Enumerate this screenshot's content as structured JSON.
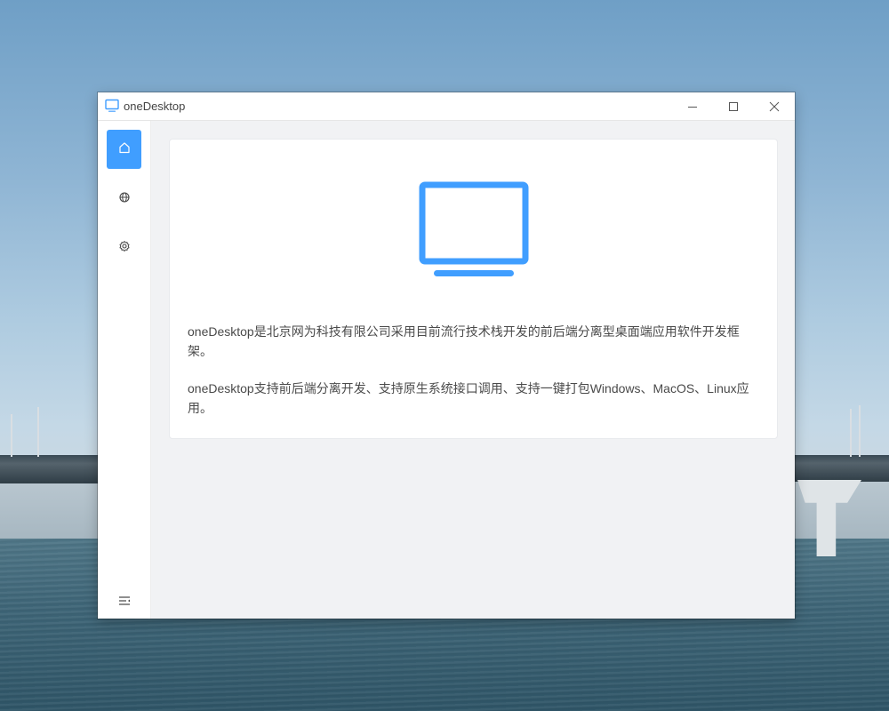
{
  "window": {
    "title": "oneDesktop",
    "controls": {
      "minimize_icon": "minimize-icon",
      "maximize_icon": "maximize-icon",
      "close_icon": "close-icon"
    }
  },
  "sidebar": {
    "items": [
      {
        "icon": "home-icon",
        "active": true
      },
      {
        "icon": "globe-icon",
        "active": false
      },
      {
        "icon": "gear-icon",
        "active": false
      }
    ],
    "bottom_icon": "menu-fold-icon"
  },
  "content": {
    "hero_icon": "monitor-icon",
    "paragraphs": [
      "oneDesktop是北京网为科技有限公司采用目前流行技术栈开发的前后端分离型桌面端应用软件开发框架。",
      "oneDesktop支持前后端分离开发、支持原生系统接口调用、支持一键打包Windows、MacOS、Linux应用。"
    ]
  },
  "colors": {
    "accent": "#409eff",
    "background": "#f1f2f4",
    "text": "#4a4a4a"
  }
}
